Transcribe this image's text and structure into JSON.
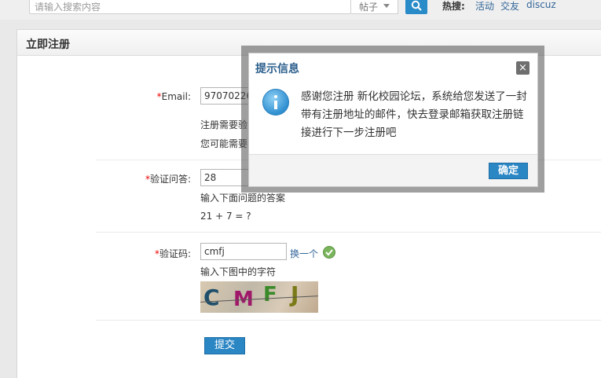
{
  "search": {
    "placeholder": "请输入搜索内容",
    "scope": "帖子",
    "hot_label": "热搜:",
    "hot_links": [
      "活动",
      "交友",
      "discuz"
    ]
  },
  "panel": {
    "title": "立即注册"
  },
  "form": {
    "email_label": "Email:",
    "email_value": "97070226",
    "email_tip_1": "注册需要验",
    "email_tip_2": "您可能需要",
    "question_label": "验证问答:",
    "question_value": "28",
    "question_tip": "输入下面问题的答案",
    "question_text": "21 + 7 = ?",
    "captcha_label": "验证码:",
    "captcha_value": "cmfj",
    "captcha_change": "换一个",
    "captcha_tip": "输入下图中的字符",
    "captcha_chars": [
      "C",
      "M",
      "F",
      "J"
    ],
    "submit_label": "提交",
    "required_mark": "*"
  },
  "dialog": {
    "title": "提示信息",
    "close_glyph": "×",
    "message": "感谢您注册 新化校园论坛，系统给您发送了一封带有注册地址的邮件，快去登录邮箱获取注册链接进行下一步注册吧",
    "confirm_label": "确定"
  },
  "colors": {
    "accent": "#2b86c4",
    "link": "#336699",
    "required": "#ee0000"
  }
}
